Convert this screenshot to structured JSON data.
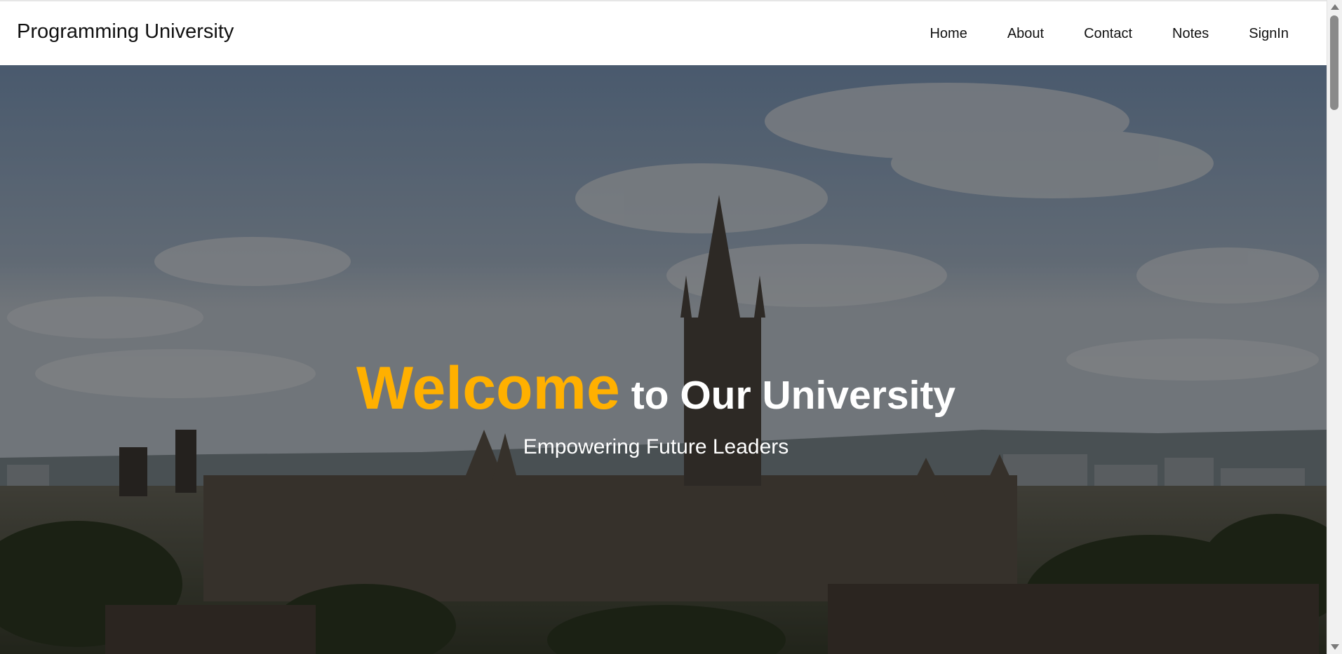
{
  "header": {
    "brand": "Programming University",
    "nav": [
      {
        "label": "Home"
      },
      {
        "label": "About"
      },
      {
        "label": "Contact"
      },
      {
        "label": "Notes"
      },
      {
        "label": "SignIn"
      }
    ]
  },
  "hero": {
    "title_accent": "Welcome",
    "title_rest": " to Our University",
    "subtitle": "Empowering Future Leaders",
    "background_icon": "university-campus-photo"
  },
  "colors": {
    "accent": "#ffb000",
    "nav_background": "#ffffff",
    "text_dark": "#111111",
    "hero_text": "#ffffff"
  }
}
